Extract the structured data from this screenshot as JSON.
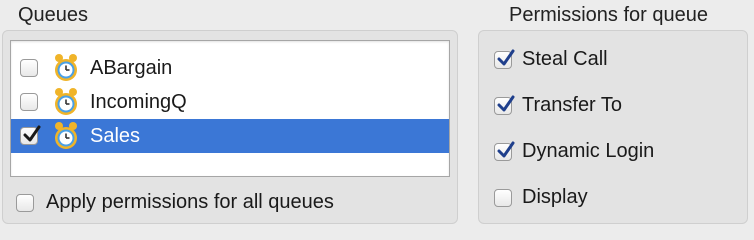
{
  "queues": {
    "title": "Queues",
    "items": [
      {
        "label": "ABargain",
        "checked": false,
        "selected": false,
        "icon": "alarm-clock-icon"
      },
      {
        "label": "IncomingQ",
        "checked": false,
        "selected": false,
        "icon": "alarm-clock-icon"
      },
      {
        "label": "Sales",
        "checked": true,
        "selected": true,
        "icon": "alarm-clock-icon"
      }
    ],
    "apply_all": {
      "label": "Apply permissions for all queues",
      "checked": false
    }
  },
  "permissions": {
    "title": "Permissions for queue",
    "items": [
      {
        "label": "Steal Call",
        "checked": true
      },
      {
        "label": "Transfer To",
        "checked": true
      },
      {
        "label": "Dynamic Login",
        "checked": true
      },
      {
        "label": "Display",
        "checked": false
      }
    ]
  },
  "colors": {
    "selection": "#3b77d6",
    "check": "#1f3f8c",
    "window_bg": "#ececec"
  }
}
